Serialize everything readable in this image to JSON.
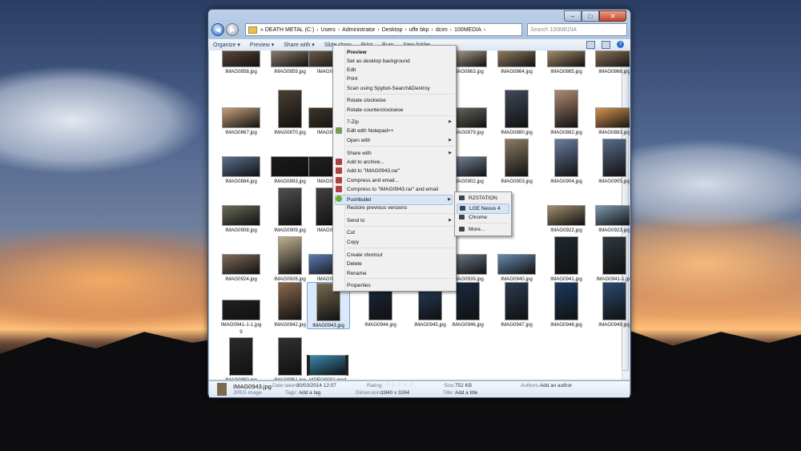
{
  "window": {
    "address": [
      "DEATH METAL (C:)",
      "Users",
      "Administrator",
      "Desktop",
      "uffe bkp",
      "dcim",
      "100MEDIA"
    ],
    "address_prefix": "«",
    "search_placeholder": "Search 100MEDIA",
    "controls": {
      "minimize": "–",
      "maximize": "□",
      "close": "✕"
    }
  },
  "toolbar": {
    "organize": "Organize ▾",
    "preview": "Preview ▾",
    "share_with": "Share with ▾",
    "slide_show": "Slide show",
    "print": "Print",
    "burn": "Burn",
    "new_folder": "New folder",
    "help": "?"
  },
  "files": [
    {
      "name": "IMAG0858.jpg",
      "c": "#5a4638"
    },
    {
      "name": "IMAG0859.jpg",
      "c": "#8a7a6a"
    },
    {
      "name": "IMAG086",
      "c": "#6a5a4a"
    },
    {
      "name": "IMAG0863.jpg",
      "c": "#b0a090"
    },
    {
      "name": "IMAG0864.jpg",
      "c": "#907a60"
    },
    {
      "name": "IMAG0865.jpg",
      "c": "#a28a6a"
    },
    {
      "name": "IMAG0866.jpg",
      "c": "#8c7055"
    },
    {
      "name": "IMAG0867.jpg",
      "c": "#c7a07a"
    },
    {
      "name": "IMAG0870.jpg",
      "c": "#4a3e30"
    },
    {
      "name": "IMAG087",
      "c": "#3e3428"
    },
    {
      "name": "IMAG0879.jpg",
      "c": "#6a6a60"
    },
    {
      "name": "IMAG0880.jpg",
      "c": "#404858"
    },
    {
      "name": "IMAG0882.jpg",
      "c": "#b08a70"
    },
    {
      "name": "IMAG0883.jpg",
      "c": "#d49250"
    },
    {
      "name": "IMAG0884.jpg",
      "c": "#5a7090"
    },
    {
      "name": "IMAG0893.jpg",
      "c": "#1a1a1a"
    },
    {
      "name": "IMAG089",
      "c": "#202020"
    },
    {
      "name": "IMAG0902.jpg",
      "c": "#7a8aa0"
    },
    {
      "name": "IMAG0903.jpg",
      "c": "#8a7a60"
    },
    {
      "name": "IMAG0904.jpg",
      "c": "#6a7aa0"
    },
    {
      "name": "IMAG0905.jpg",
      "c": "#5a6a8a"
    },
    {
      "name": "IMAG0908.jpg",
      "c": "#6a6a5a"
    },
    {
      "name": "IMAG0909.jpg",
      "c": "#505050"
    },
    {
      "name": "IMAG091",
      "c": "#404040"
    },
    {
      "name": "IMAG0922.jpg",
      "c": "#a09070"
    },
    {
      "name": "IMAG0923.jpg",
      "c": "#7a9ab0"
    },
    {
      "name": "IMAG0924.jpg",
      "c": "#806a5a"
    },
    {
      "name": "IMAG0926.jpg",
      "c": "#c0b090"
    },
    {
      "name": "IMAG092",
      "c": "#5a7ab0"
    },
    {
      "name": "IMAG0939.jpg",
      "c": "#708090"
    },
    {
      "name": "IMAG0940.jpg",
      "c": "#6a8ab0"
    },
    {
      "name": "IMAG0941.jpg",
      "c": "#202830"
    },
    {
      "name": "IMAG0941-1.jpg",
      "c": "#303840"
    },
    {
      "name": "IMAG0941-1-1.jpg",
      "c": "#202020"
    },
    {
      "name": "IMAG0942.jpg",
      "c": "#8a6a50"
    },
    {
      "name": "IMAG0943.jpg",
      "c": "#7a6a50"
    },
    {
      "name": "IMAG0944.jpg",
      "c": "#1a2a40"
    },
    {
      "name": "IMAG0945.jpg",
      "c": "#2a4060"
    },
    {
      "name": "IMAG0946.jpg",
      "c": "#1a2a40"
    },
    {
      "name": "IMAG0947.jpg",
      "c": "#2a3a50"
    },
    {
      "name": "IMAG0948.jpg",
      "c": "#1a3a60"
    },
    {
      "name": "IMAG0949.jpg",
      "c": "#2a4a70"
    },
    {
      "name": "IMAG0950.jpg",
      "c": "#2a2a2a"
    },
    {
      "name": "IMAG0951.jpg",
      "c": "#303030"
    },
    {
      "name": "VIDEO0002.mp4",
      "c": "#3a8ab0"
    }
  ],
  "file_wrap_suffix": "9",
  "context_menu": {
    "items": [
      "Preview",
      "Set as desktop background",
      "Edit",
      "Print",
      "Scan using Spybot-Search&Destroy",
      "Rotate clockwise",
      "Rotate counterclockwise",
      "7-Zip",
      "Edit with Notepad++",
      "Open with",
      "Share with",
      "Add to archive...",
      "Add to \"IMAG0943.rar\"",
      "Compress and email...",
      "Compress to \"IMAG0943.rar\" and email",
      "Pushbullet",
      "Restore previous versions",
      "Send to",
      "Cut",
      "Copy",
      "Create shortcut",
      "Delete",
      "Rename",
      "Properties"
    ],
    "arrow": "▶"
  },
  "submenu": {
    "items": [
      "RZSTATION",
      "LGE Nexus 4",
      "Chrome",
      "More..."
    ]
  },
  "details": {
    "filename": "IMAG0943.jpg",
    "filetype": "JPEG image",
    "date_taken_key": "Date taken:",
    "date_taken": "30/03/2014 12:07",
    "tags_key": "Tags:",
    "tags": "Add a tag",
    "rating_key": "Rating:",
    "rating_stars": "☆☆☆☆☆",
    "dimensions_key": "Dimensions:",
    "dimensions": "1840 x 3264",
    "size_key": "Size:",
    "size": "752 KB",
    "title_key": "Title:",
    "title": "Add a title",
    "authors_key": "Authors:",
    "authors": "Add an author"
  }
}
